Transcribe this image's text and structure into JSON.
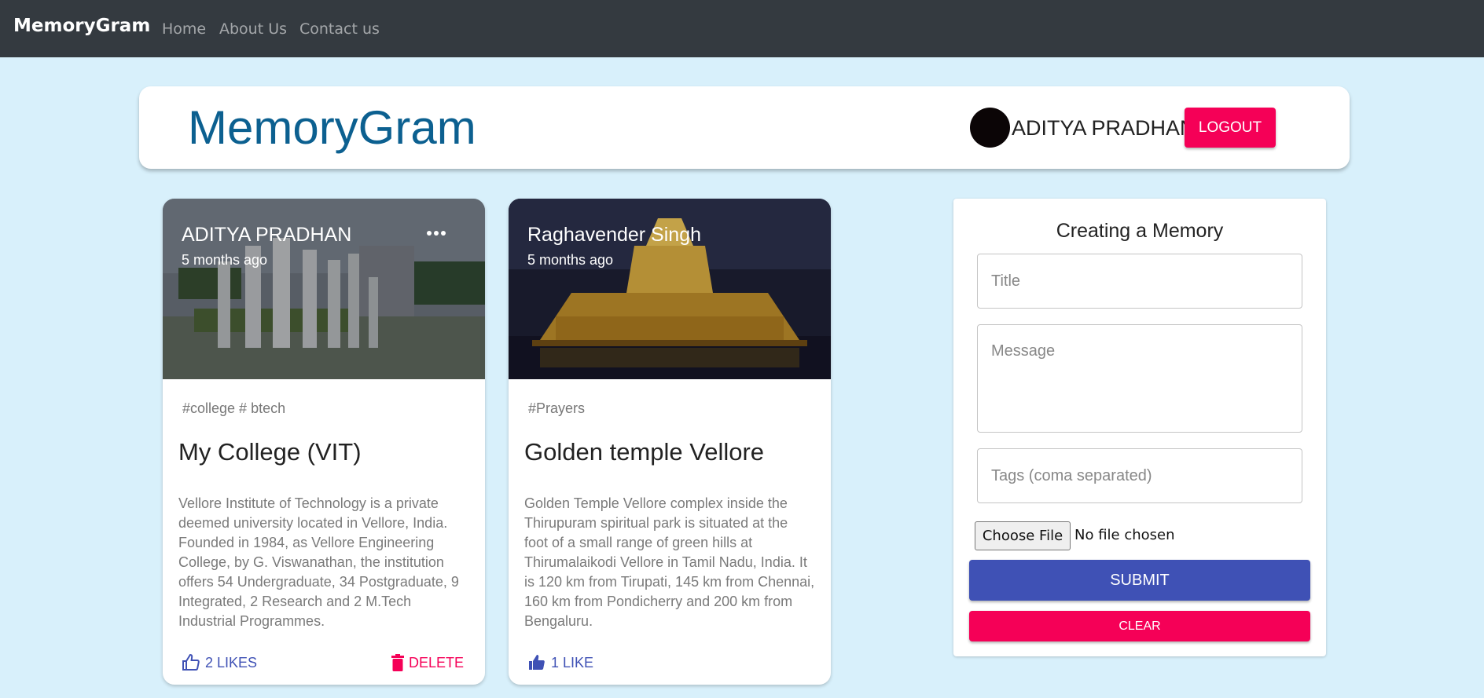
{
  "navbar": {
    "brand": "MemoryGram",
    "links": [
      "Home",
      "About Us",
      "Contact us"
    ]
  },
  "header": {
    "title": "MemoryGram",
    "user_name": "ADITYA PRADHAN",
    "logout_label": "LOGOUT"
  },
  "posts": [
    {
      "author": "ADITYA PRADHAN",
      "time": "5 months ago",
      "tags": "#college # btech",
      "title": "My College (VIT)",
      "message": "Vellore Institute of Technology is a private deemed university located in Vellore, India. Founded in 1984, as Vellore Engineering College, by G. Viswanathan, the institution offers 54 Undergraduate, 34 Postgraduate, 9 Integrated, 2 Research and 2 M.Tech Industrial Programmes.",
      "likes_label": "2 LIKES",
      "delete_label": "DELETE",
      "image_icon": "campus-photo"
    },
    {
      "author": "Raghavender Singh",
      "time": "5 months ago",
      "tags": "#Prayers",
      "title": "Golden temple Vellore",
      "message": "Golden Temple Vellore complex inside the Thirupuram spiritual park is situated at the foot of a small range of green hills at Thirumalaikodi Vellore in Tamil Nadu, India. It is 120 km from Tirupati, 145 km from Chennai, 160 km from Pondicherry and 200 km from Bengaluru.",
      "likes_label": "1 LIKE",
      "image_icon": "temple-photo"
    }
  ],
  "form": {
    "title": "Creating a Memory",
    "title_placeholder": "Title",
    "message_placeholder": "Message",
    "tags_placeholder": "Tags (coma separated)",
    "file_button": "Choose File",
    "file_status": "No file chosen",
    "submit_label": "SUBMIT",
    "clear_label": "CLEAR"
  },
  "colors": {
    "navbar": "#343a40",
    "background": "#d8f0fb",
    "heading": "#0c6090",
    "primary": "#3f51b5",
    "secondary": "#f50057"
  }
}
